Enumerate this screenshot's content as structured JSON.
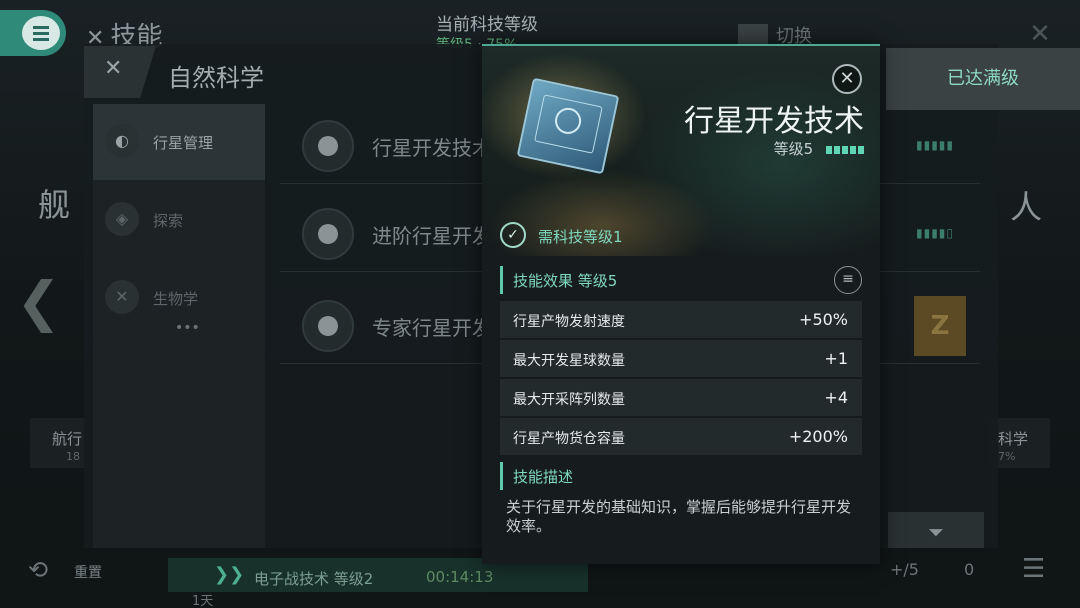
{
  "background": {
    "top_title": "技能",
    "tech_level_label": "当前科技等级",
    "tech_level_sub": "等级5 · 75%",
    "switch_label": "切换",
    "panel_title": "自然科学",
    "categories": [
      {
        "label": "行星管理",
        "icon": "planet-icon"
      },
      {
        "label": "探索",
        "icon": "explore-icon"
      },
      {
        "label": "生物学",
        "icon": "dna-icon"
      }
    ],
    "skills": [
      {
        "name": "行星开发技术",
        "level_pips": "▮▮▮▮▮"
      },
      {
        "name": "进阶行星开发",
        "level_pips": "▮▮▮▮▯"
      },
      {
        "name": "专家行星开发",
        "level_pips": ""
      }
    ],
    "left_big_char": "舰",
    "left_card_label": "航行",
    "left_card_sub": "18",
    "right_big_char": "人",
    "right_card_label": "科学",
    "right_card_sub": "7%",
    "maxed_label": "已达满级",
    "badge_letter": "Z",
    "bottom": {
      "reset_label": "重置",
      "researching_text": "电子战技术 等级2",
      "timer": "00:14:13",
      "day_label": "1天",
      "queue_text": "+/5",
      "flask_count": "0"
    }
  },
  "modal": {
    "title": "行星开发技术",
    "level_label": "等级5",
    "level_value": 5,
    "level_max": 5,
    "requirement": "需科技等级1",
    "effects_header": "技能效果 等级5",
    "effects": [
      {
        "name": "行星产物发射速度",
        "value": "+50%"
      },
      {
        "name": "最大开发星球数量",
        "value": "+1"
      },
      {
        "name": "最大开采阵列数量",
        "value": "+4"
      },
      {
        "name": "行星产物货仓容量",
        "value": "+200%"
      }
    ],
    "description_header": "技能描述",
    "description": "关于行星开发的基础知识，掌握后能够提升行星开发效率。"
  },
  "colors": {
    "accent": "#5ec9ad",
    "menu_button": "#2f8a7a",
    "modal_bg": "#161c1d",
    "effect_row_bg": "#232a2c"
  }
}
